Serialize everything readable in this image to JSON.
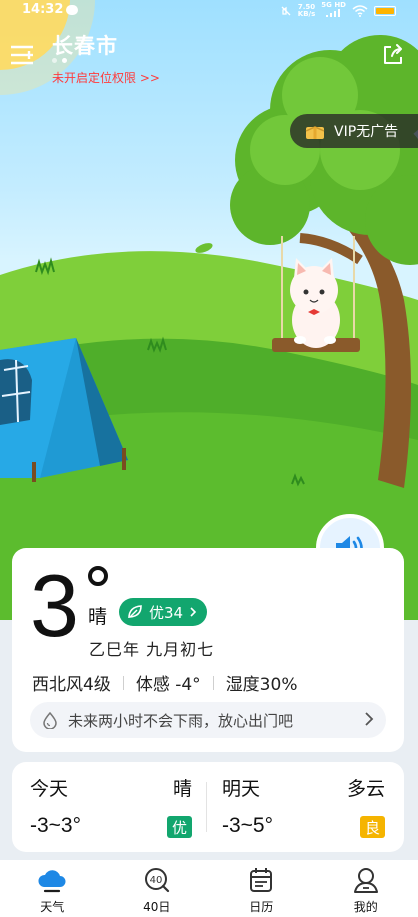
{
  "status_bar": {
    "time": "14:32",
    "net_speed_value": "7.50",
    "net_speed_unit": "KB/s",
    "signal_label": "5G HD"
  },
  "header": {
    "city": "长春市",
    "location_warning": "未开启定位权限 >>",
    "page_dots": 2,
    "active_dot": 1
  },
  "vip": {
    "label": "VIP无广告"
  },
  "current": {
    "temperature": "3",
    "condition": "晴",
    "aqi_label": "优34",
    "lunar_date": "乙巳年 九月初七",
    "wind": "西北风4级",
    "feels_like": "体感 -4°",
    "humidity": "湿度30%",
    "rain_forecast": "未来两小时不会下雨，放心出门吧"
  },
  "forecast": [
    {
      "day": "今天",
      "weather": "晴",
      "range": "-3~3°",
      "aqi": "优",
      "aqi_color": "#12a66e"
    },
    {
      "day": "明天",
      "weather": "多云",
      "range": "-3~5°",
      "aqi": "良",
      "aqi_color": "#f5b400"
    }
  ],
  "nav": [
    {
      "label": "天气",
      "icon": "weather-icon",
      "active": true
    },
    {
      "label": "40日",
      "icon": "forty-day-icon",
      "active": false
    },
    {
      "label": "日历",
      "icon": "calendar-icon",
      "active": false
    },
    {
      "label": "我的",
      "icon": "profile-icon",
      "active": false
    }
  ],
  "colors": {
    "accent_blue": "#1e88e5",
    "aqi_good": "#12a66e",
    "aqi_moderate": "#f5b400",
    "warning_red": "#ff3b3b"
  }
}
